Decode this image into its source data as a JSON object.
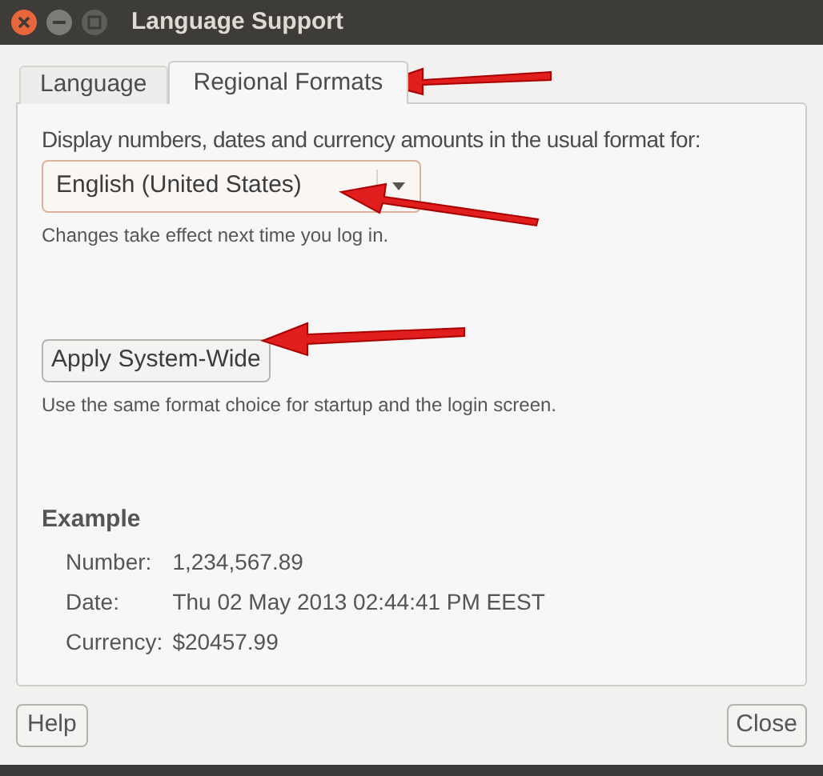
{
  "window": {
    "title": "Language Support"
  },
  "tabs": [
    {
      "label": "Language",
      "selected": false
    },
    {
      "label": "Regional Formats",
      "selected": true
    }
  ],
  "prompt": "Display numbers, dates and currency amounts in the usual format for:",
  "format_dropdown": {
    "value": "English (United States)"
  },
  "format_hint": "Changes take effect next time you log in.",
  "apply_button": "Apply System-Wide",
  "apply_hint": "Use the same format choice for startup and the login screen.",
  "example": {
    "heading": "Example",
    "rows": [
      {
        "label": "Number:",
        "value": "1,234,567.89"
      },
      {
        "label": "Date:",
        "value": "Thu 02 May 2013 02:44:41 PM EEST"
      },
      {
        "label": "Currency:",
        "value": "$20457.99"
      }
    ]
  },
  "buttons": {
    "left": "Help",
    "right": "Close"
  }
}
